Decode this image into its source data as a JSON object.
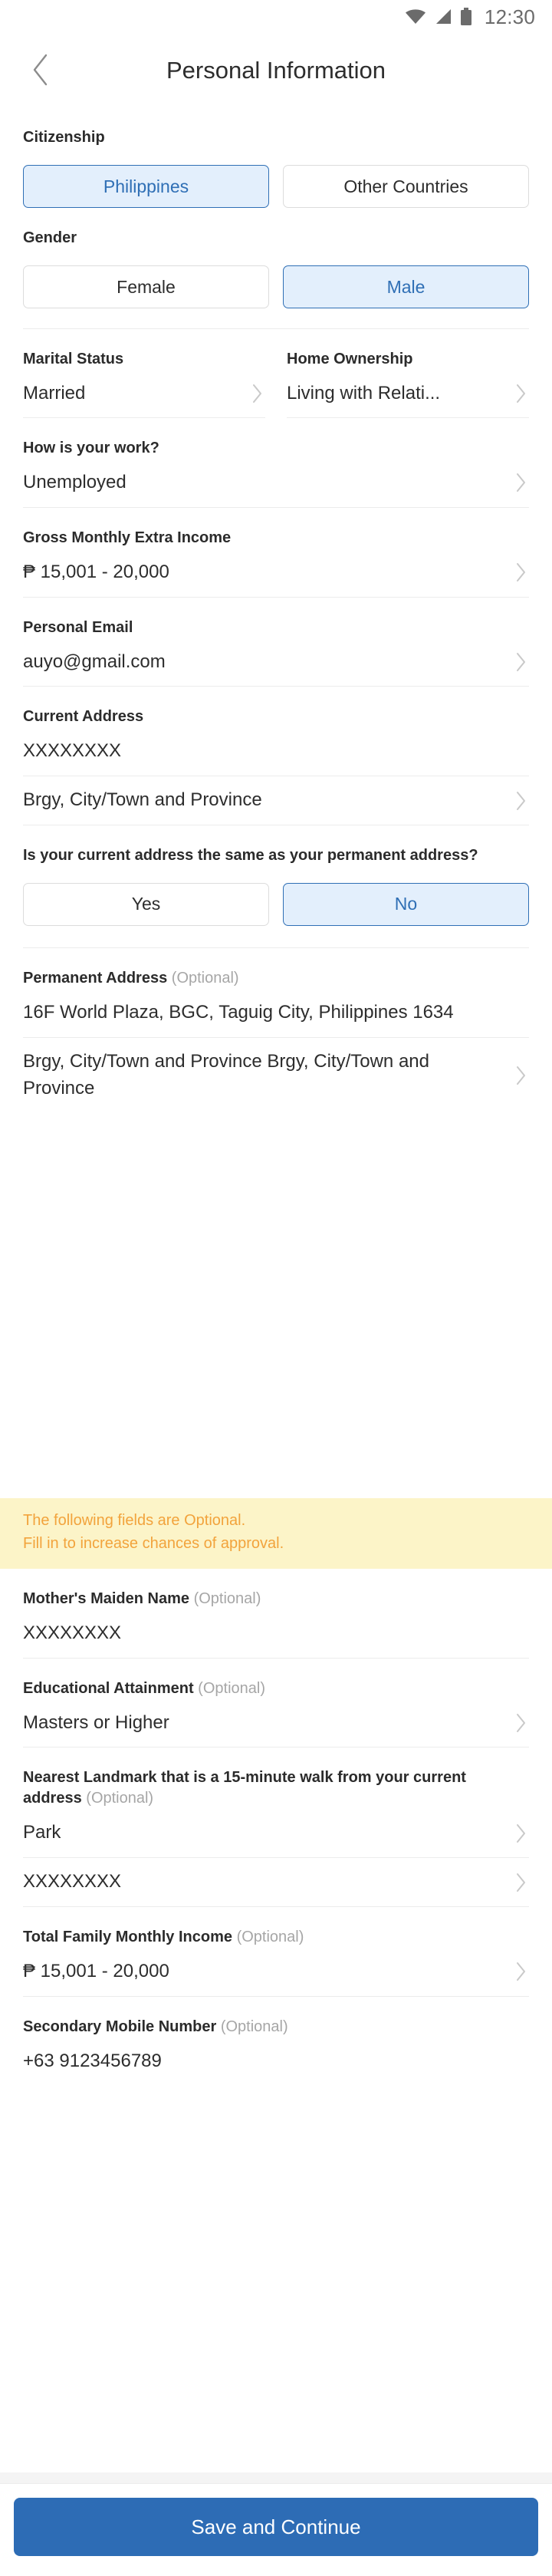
{
  "statusbar": {
    "time": "12:30",
    "icons": [
      "wifi-icon",
      "signal-icon",
      "battery-icon"
    ]
  },
  "header": {
    "title": "Personal Information",
    "back_icon": "chevron-left-icon"
  },
  "colors": {
    "accent": "#2d6cb5",
    "selected_bg": "#e3effc",
    "selected_border": "#2f6fb5",
    "banner_bg": "#fcf4c8",
    "banner_text": "#f2a33c",
    "divider": "#ececec",
    "optional_label": "#a6a6a6"
  },
  "citizenship": {
    "label": "Citizenship",
    "options": [
      {
        "label": "Philippines",
        "selected": true
      },
      {
        "label": "Other Countries",
        "selected": false
      }
    ]
  },
  "gender": {
    "label": "Gender",
    "options": [
      {
        "label": "Female",
        "selected": false
      },
      {
        "label": "Male",
        "selected": true
      }
    ]
  },
  "marital_status": {
    "label": "Marital Status",
    "value": "Married"
  },
  "home_ownership": {
    "label": "Home Ownership",
    "value": "Living with Relati..."
  },
  "work": {
    "label": "How is your work?",
    "value": "Unemployed"
  },
  "gross_extra_income": {
    "label": "Gross Monthly Extra Income",
    "value": "₱ 15,001 - 20,000"
  },
  "personal_email": {
    "label": "Personal Email",
    "value": "auyo@gmail.com"
  },
  "current_address": {
    "label": "Current Address",
    "line1": "XXXXXXXX",
    "line2": "Brgy, City/Town and Province"
  },
  "same_address": {
    "label": "Is your current address the same as your permanent address?",
    "options": [
      {
        "label": "Yes",
        "selected": false
      },
      {
        "label": "No",
        "selected": true
      }
    ]
  },
  "permanent_address": {
    "label": "Permanent Address",
    "optional": "(Optional)",
    "line1": "16F World Plaza, BGC, Taguig City, Philippines 1634",
    "line2": "Brgy, City/Town and Province Brgy, City/Town and Province"
  },
  "optional_banner": {
    "line1": "The following fields are Optional.",
    "line2": "Fill in to increase chances of approval."
  },
  "mothers_maiden_name": {
    "label": "Mother's Maiden Name",
    "optional": "(Optional)",
    "value": "XXXXXXXX"
  },
  "educational_attainment": {
    "label": "Educational Attainment",
    "optional": "(Optional)",
    "value": "Masters or Higher"
  },
  "nearest_landmark": {
    "label": "Nearest Landmark that is a 15-minute walk from your current address",
    "optional": "(Optional)",
    "value1": "Park",
    "value2": "XXXXXXXX"
  },
  "family_income": {
    "label": "Total Family Monthly Income",
    "optional": "(Optional)",
    "value": "₱ 15,001 - 20,000"
  },
  "secondary_mobile": {
    "label": "Secondary Mobile Number",
    "optional": "(Optional)",
    "value": "+63 9123456789"
  },
  "footer": {
    "submit_label": "Save and Continue"
  }
}
